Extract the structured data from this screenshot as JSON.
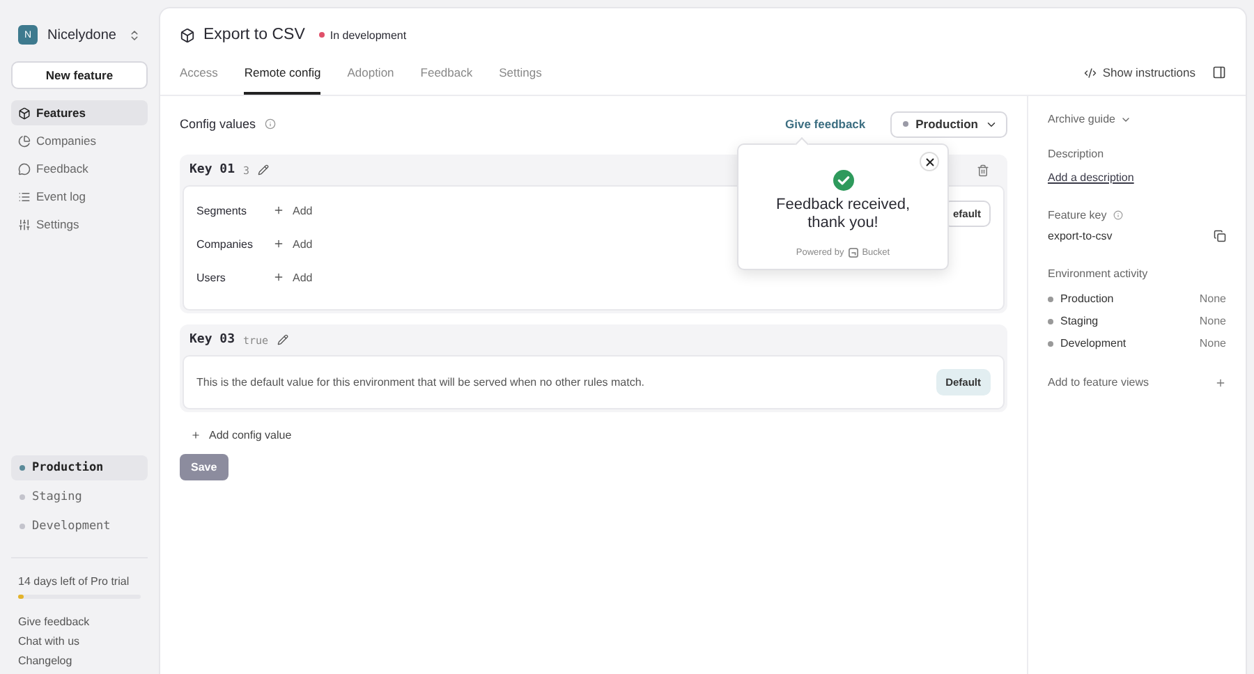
{
  "sidebar": {
    "org": {
      "initial": "N",
      "name": "Nicelydone"
    },
    "new_feature_button": "New feature",
    "nav": [
      {
        "kind": "features",
        "label": "Features",
        "selected": true
      },
      {
        "kind": "companies",
        "label": "Companies",
        "selected": false
      },
      {
        "kind": "feedback",
        "label": "Feedback",
        "selected": false
      },
      {
        "kind": "events",
        "label": "Event log",
        "selected": false
      },
      {
        "kind": "settings",
        "label": "Settings",
        "selected": false
      }
    ],
    "environments": [
      {
        "label": "Production",
        "selected": true
      },
      {
        "label": "Staging",
        "selected": false
      },
      {
        "label": "Development",
        "selected": false
      }
    ],
    "trial": {
      "text": "14 days left of Pro trial",
      "level": 0.04
    },
    "links": [
      "Give feedback",
      "Chat with us",
      "Changelog"
    ]
  },
  "feature": {
    "title": "Export to CSV",
    "status": "In development"
  },
  "tabs": [
    {
      "label": "Access",
      "selected": false
    },
    {
      "label": "Remote config",
      "selected": true
    },
    {
      "label": "Adoption",
      "selected": false
    },
    {
      "label": "Feedback",
      "selected": false
    },
    {
      "label": "Settings",
      "selected": false
    }
  ],
  "show_instructions": "Show instructions",
  "config": {
    "title": "Config values",
    "give_feedback": "Give feedback",
    "environment": "Production",
    "keys": [
      {
        "kind": "rules",
        "name": "Key 01",
        "value": "3",
        "badge": "efault",
        "rules": [
          {
            "label": "Segments",
            "action": "Add"
          },
          {
            "label": "Companies",
            "action": "Add"
          },
          {
            "label": "Users",
            "action": "Add"
          }
        ]
      },
      {
        "kind": "default",
        "name": "Key 03",
        "value": "true",
        "description": "This is the default value for this environment that will be served when no other rules match.",
        "badge": "Default"
      }
    ],
    "add_button": "Add config value",
    "save_button": {
      "label": "Save",
      "disabled": true
    }
  },
  "feedback_popup": {
    "message": "Feedback received, thank you!",
    "powered_by": "Powered by",
    "brand": "Bucket"
  },
  "details": {
    "archive_guide": "Archive guide",
    "description_label": "Description",
    "description_link": "Add a description",
    "feature_key_label": "Feature key",
    "feature_key": "export-to-csv",
    "activity_label": "Environment activity",
    "activity": [
      {
        "env": "Production",
        "value": "None"
      },
      {
        "env": "Staging",
        "value": "None"
      },
      {
        "env": "Development",
        "value": "None"
      }
    ],
    "feature_views": "Add to feature views"
  }
}
